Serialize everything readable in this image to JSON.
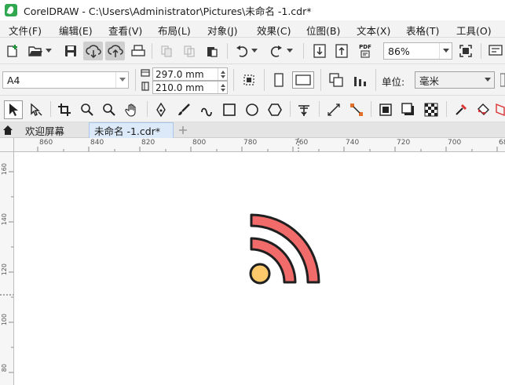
{
  "window": {
    "title": "CorelDRAW - C:\\Users\\Administrator\\Pictures\\未命名 -1.cdr*"
  },
  "menu": [
    {
      "label": "文件(F)"
    },
    {
      "label": "编辑(E)"
    },
    {
      "label": "查看(V)"
    },
    {
      "label": "布局(L)"
    },
    {
      "label": "对象(J)"
    },
    {
      "label": "效果(C)"
    },
    {
      "label": "位图(B)"
    },
    {
      "label": "文本(X)"
    },
    {
      "label": "表格(T)"
    },
    {
      "label": "工具(O)"
    }
  ],
  "standard_toolbar": {
    "zoom_value": "86%",
    "pdf_label": "PDF"
  },
  "property_bar": {
    "page_size": "A4",
    "width_value": "297.0 mm",
    "height_value": "210.0 mm",
    "units_label": "单位:",
    "units_value": "毫米"
  },
  "tabs": [
    {
      "label": "欢迎屏幕"
    },
    {
      "label": "未命名 -1.cdr*"
    }
  ],
  "ruler": {
    "horizontal": [
      "860",
      "840",
      "820",
      "800",
      "780",
      "760",
      "740",
      "720",
      "700",
      "680"
    ],
    "vertical": [
      "160",
      "140",
      "120",
      "100",
      "80"
    ]
  },
  "colors": {
    "rss_arc_fill": "#f26b6b",
    "rss_dot_fill": "#fec96b",
    "outline": "#1f1f1f"
  }
}
